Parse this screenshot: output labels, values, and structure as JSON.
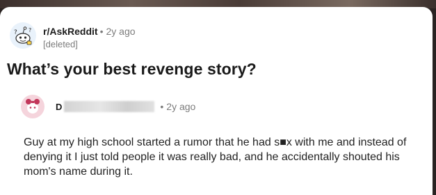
{
  "post": {
    "subreddit": "r/AskReddit",
    "separator": "•",
    "age": "2y ago",
    "author": "[deleted]",
    "title": "What’s your best revenge story?"
  },
  "comment": {
    "username": "D",
    "separator": "•",
    "age": "2y ago",
    "body": "Guy at my high school started a rumor that he had s■x with me and instead of denying it I just told people it was really bad, and he accidentally shouted his mom's name during it."
  },
  "icons": {
    "subreddit_avatar": "reddit-snoo-icon",
    "user_avatar": "reddit-user-avatar-icon"
  },
  "colors": {
    "title": "#1a1a1a",
    "meta": "#7c7c7c",
    "sub_avatar_bg": "#e9f2fb",
    "user_avatar_bg": "#f5d4dc",
    "user_avatar_accent": "#c2365a"
  }
}
